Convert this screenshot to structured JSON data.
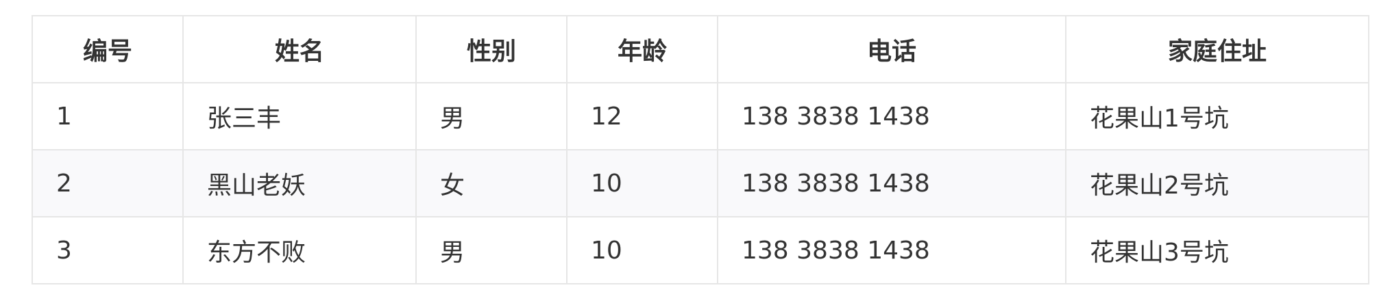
{
  "table": {
    "headers": [
      "编号",
      "姓名",
      "性别",
      "年龄",
      "电话",
      "家庭住址"
    ],
    "rows": [
      [
        "1",
        "张三丰",
        "男",
        "12",
        "138 3838 1438",
        "花果山1号坑"
      ],
      [
        "2",
        "黑山老妖",
        "女",
        "10",
        "138 3838 1438",
        "花果山2号坑"
      ],
      [
        "3",
        "东方不败",
        "男",
        "10",
        "138 3838 1438",
        "花果山3号坑"
      ]
    ]
  },
  "colors": {
    "border": "#e6e6e6",
    "stripe": "#f9f9fb",
    "text": "#333333"
  }
}
